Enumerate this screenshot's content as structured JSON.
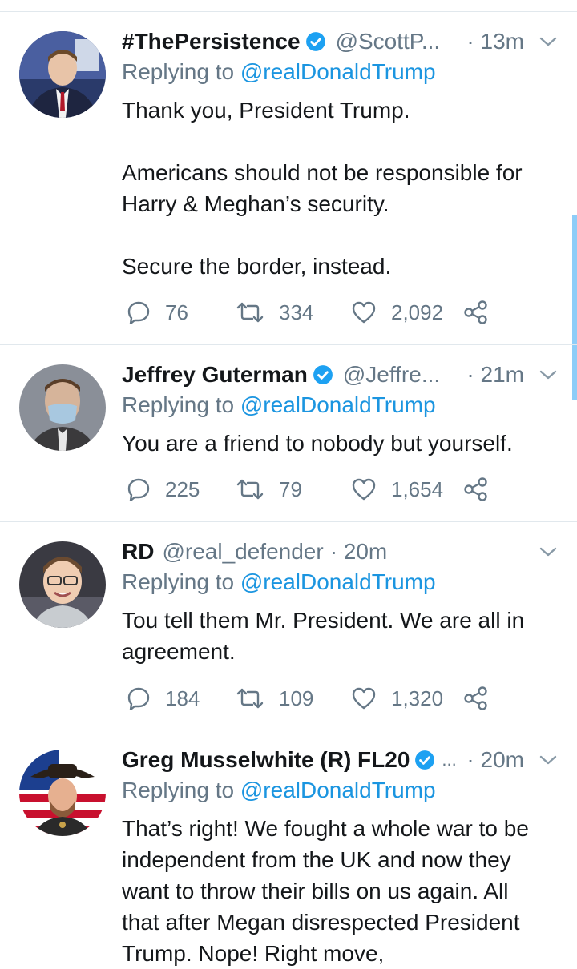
{
  "tweets": [
    {
      "name": "#ThePersistence",
      "verified": true,
      "handle": "@ScottP...",
      "time": "· 13m",
      "replying_prefix": "Replying to",
      "replying_to": "@realDonaldTrump",
      "body": [
        "Thank you, President Trump.",
        "",
        "Americans should not be responsible for",
        "Harry & Meghan’s security.",
        "",
        "Secure the border, instead."
      ],
      "replies": "76",
      "retweets": "334",
      "likes": "2,092"
    },
    {
      "name": "Jeffrey Guterman",
      "verified": true,
      "handle": "@Jeffre...",
      "time": "· 21m",
      "replying_prefix": "Replying to",
      "replying_to": "@realDonaldTrump",
      "body": [
        "You are a friend to nobody but yourself."
      ],
      "replies": "225",
      "retweets": "79",
      "likes": "1,654"
    },
    {
      "name": "RD",
      "verified": false,
      "handle": "@real_defender",
      "time": "· 20m",
      "replying_prefix": "Replying to",
      "replying_to": "@realDonaldTrump",
      "body": [
        "Tou tell them Mr. President. We are all in",
        "agreement."
      ],
      "replies": "184",
      "retweets": "109",
      "likes": "1,320"
    },
    {
      "name": "Greg Musselwhite (R) FL20",
      "verified": true,
      "handle": "...",
      "time": "· 20m",
      "replying_prefix": "Replying to",
      "replying_to": "@realDonaldTrump",
      "body": [
        "That’s right! We fought a whole war to be",
        "independent from the UK and now they",
        "want to throw their bills on us again. All",
        "that after Megan disrespected President",
        "Trump. Nope! Right move,"
      ]
    }
  ],
  "colors": {
    "link": "#1b95e0",
    "secondary_text": "#657786",
    "divider": "#e1e8ed",
    "verified": "#1da1f2"
  },
  "icons": [
    "reply-icon",
    "retweet-icon",
    "like-icon",
    "share-icon",
    "chevron-down-icon",
    "verified-badge-icon"
  ]
}
